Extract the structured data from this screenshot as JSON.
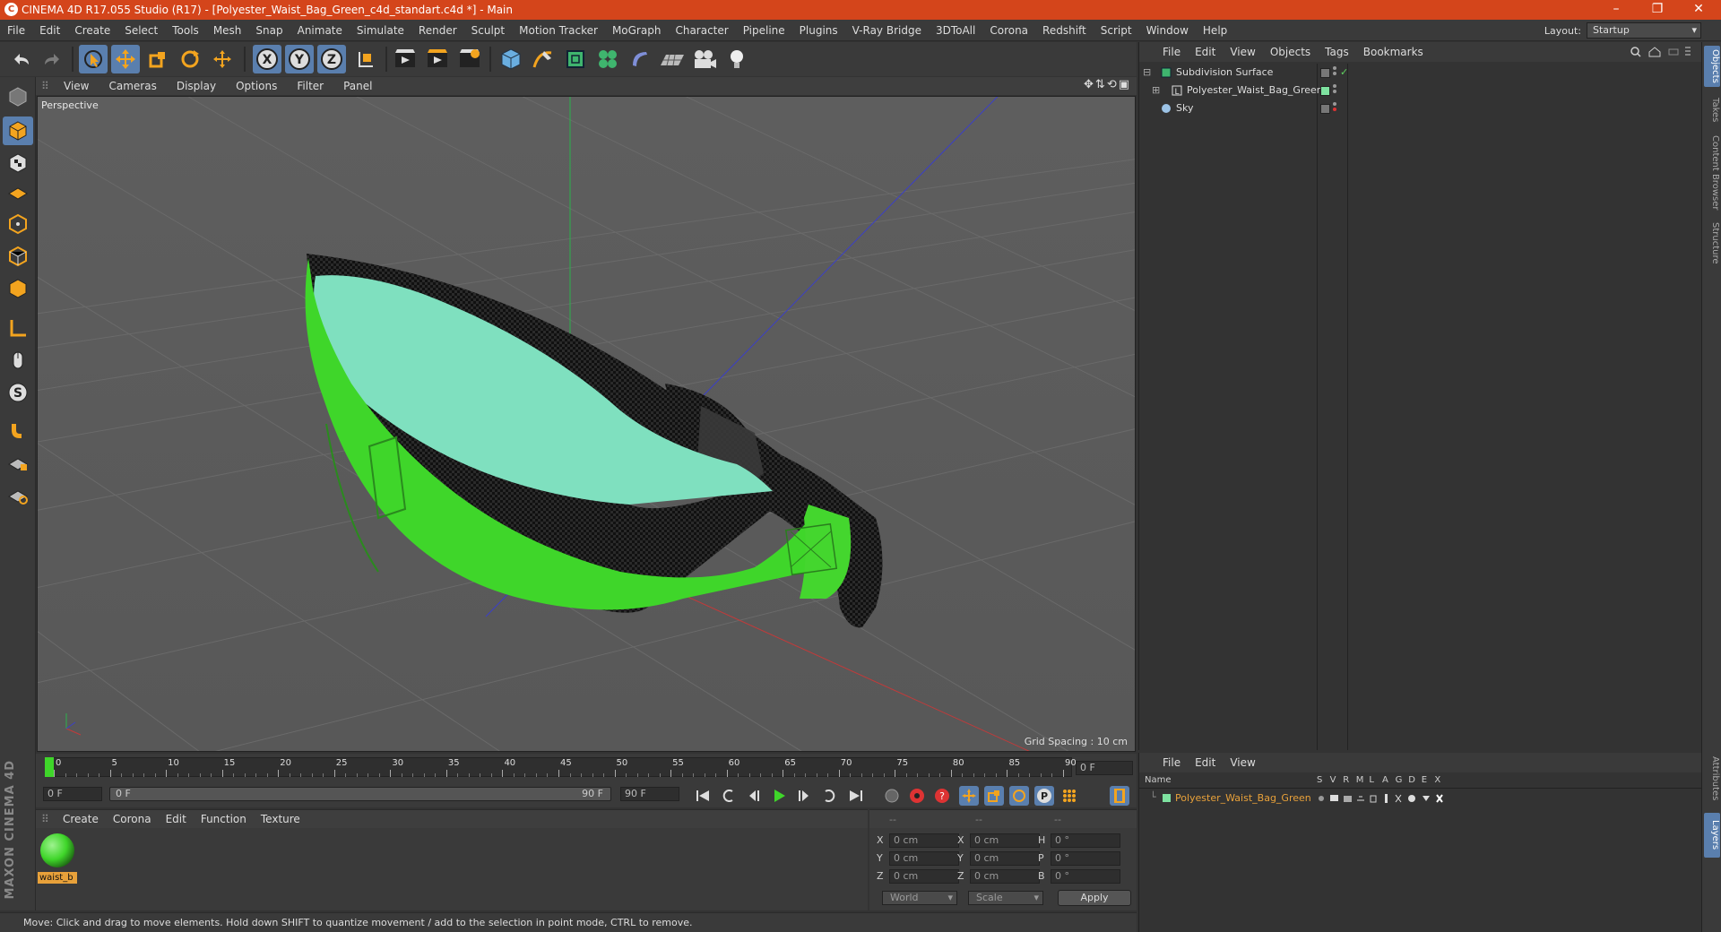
{
  "window": {
    "title": "CINEMA 4D R17.055 Studio (R17) - [Polyester_Waist_Bag_Green_c4d_standart.c4d *] - Main",
    "controls": [
      "–",
      "❐",
      "✕"
    ]
  },
  "menu": [
    "File",
    "Edit",
    "Create",
    "Select",
    "Tools",
    "Mesh",
    "Snap",
    "Animate",
    "Simulate",
    "Render",
    "Sculpt",
    "Motion Tracker",
    "MoGraph",
    "Character",
    "Pipeline",
    "Plugins",
    "V-Ray Bridge",
    "3DToAll",
    "Corona",
    "Redshift",
    "Script",
    "Window",
    "Help"
  ],
  "layout": {
    "label": "Layout:",
    "value": "Startup"
  },
  "viewport": {
    "menu": [
      "View",
      "Cameras",
      "Display",
      "Options",
      "Filter",
      "Panel"
    ],
    "label": "Perspective",
    "grid_spacing": "Grid Spacing : 10 cm"
  },
  "timeline": {
    "ticks": [
      "0",
      "5",
      "10",
      "15",
      "20",
      "25",
      "30",
      "35",
      "40",
      "45",
      "50",
      "55",
      "60",
      "65",
      "70",
      "75",
      "80",
      "85",
      "90"
    ],
    "current": "0 F"
  },
  "playback": {
    "start": "0 F",
    "range_start": "0 F",
    "range_end": "90 F",
    "end": "90 F"
  },
  "material_panel": {
    "menu": [
      "Create",
      "Corona",
      "Edit",
      "Function",
      "Texture"
    ],
    "material_name": "waist_b"
  },
  "coordinates": {
    "headers": [
      "--",
      "--",
      "--"
    ],
    "rows": [
      {
        "a": "X",
        "av": "0 cm",
        "b": "X",
        "bv": "0 cm",
        "c": "H",
        "cv": "0 °"
      },
      {
        "a": "Y",
        "av": "0 cm",
        "b": "Y",
        "bv": "0 cm",
        "c": "P",
        "cv": "0 °"
      },
      {
        "a": "Z",
        "av": "0 cm",
        "b": "Z",
        "bv": "0 cm",
        "c": "B",
        "cv": "0 °"
      }
    ],
    "mode": "World",
    "type": "Scale",
    "apply": "Apply"
  },
  "status": "Move: Click and drag to move elements. Hold down SHIFT to quantize movement / add to the selection in point mode, CTRL to remove.",
  "objects": {
    "menu": [
      "File",
      "Edit",
      "View",
      "Objects",
      "Tags",
      "Bookmarks"
    ],
    "items": [
      {
        "name": "Subdivision Surface"
      },
      {
        "name": "Polyester_Waist_Bag_Green"
      },
      {
        "name": "Sky"
      }
    ]
  },
  "layers": {
    "menu": [
      "File",
      "Edit",
      "View"
    ],
    "columns": [
      "Name",
      "S",
      "V",
      "R",
      "M",
      "L",
      "A",
      "G",
      "D",
      "E",
      "X"
    ],
    "items": [
      {
        "name": "Polyester_Waist_Bag_Green"
      }
    ]
  },
  "side_tabs": [
    "Objects",
    "Takes",
    "Content Browser",
    "Structure",
    "Attributes",
    "Layers"
  ],
  "brand": "MAXON CINEMA 4D",
  "colors": {
    "title": "#d4451b",
    "accent": "#5a7fae",
    "bag": "#3fd62a",
    "layer_text": "#e8a13a"
  }
}
